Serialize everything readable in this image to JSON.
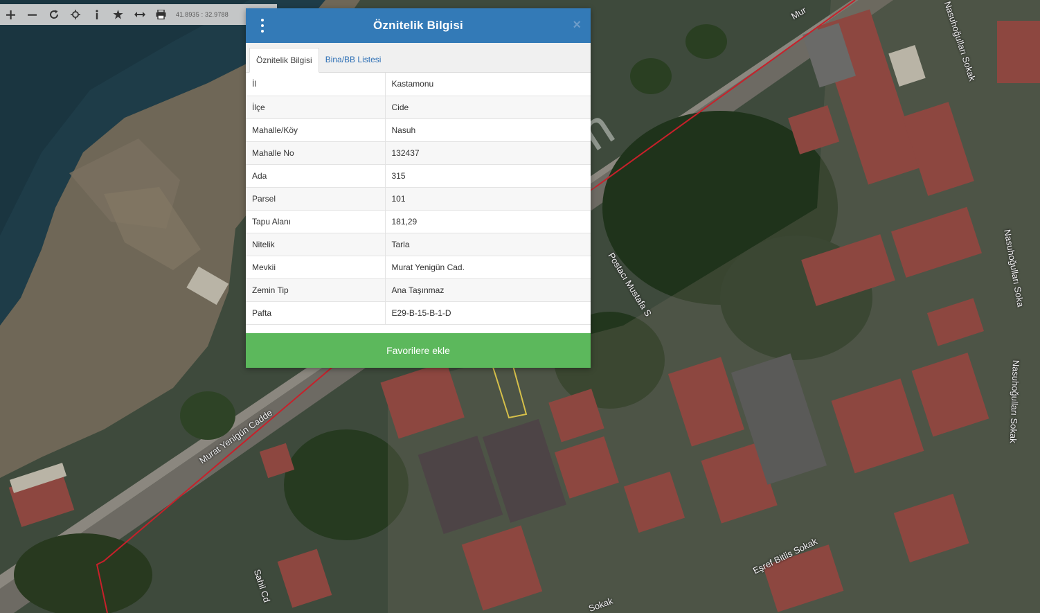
{
  "toolbar": {
    "tools": [
      {
        "name": "zoom-in-icon",
        "glyph": "+"
      },
      {
        "name": "zoom-out-icon",
        "glyph": "−"
      },
      {
        "name": "refresh-icon",
        "glyph": "⟳"
      },
      {
        "name": "locate-icon",
        "glyph": "✥"
      },
      {
        "name": "info-icon",
        "glyph": "i"
      },
      {
        "name": "star-icon",
        "glyph": "★"
      },
      {
        "name": "measure-icon",
        "glyph": "↔"
      },
      {
        "name": "print-icon",
        "glyph": "⎙"
      }
    ],
    "coordinates": "41.8935 : 32.9788"
  },
  "dialog": {
    "title": "Öznitelik Bilgisi",
    "close_glyph": "×",
    "tabs": [
      {
        "label": "Öznitelik Bilgisi",
        "active": true
      },
      {
        "label": "Bina/BB Listesi",
        "active": false
      }
    ],
    "rows": [
      {
        "key": "İl",
        "value": "Kastamonu"
      },
      {
        "key": "İlçe",
        "value": "Cide"
      },
      {
        "key": "Mahalle/Köy",
        "value": "Nasuh"
      },
      {
        "key": "Mahalle No",
        "value": "132437"
      },
      {
        "key": "Ada",
        "value": "315"
      },
      {
        "key": "Parsel",
        "value": "101"
      },
      {
        "key": "Tapu Alanı",
        "value": "181,29"
      },
      {
        "key": "Nitelik",
        "value": "Tarla"
      },
      {
        "key": "Mevkii",
        "value": "Murat Yenigün Cad."
      },
      {
        "key": "Zemin Tip",
        "value": "Ana Taşınmaz"
      },
      {
        "key": "Pafta",
        "value": "E29-B-15-B-1-D"
      }
    ],
    "favorite_button": "Favorilere ekle"
  },
  "map": {
    "streets": {
      "murat_yenigun": "Murat Yenigün Cadde",
      "murat_top": "Mur",
      "postaci": "Postacı Mustafa S",
      "nasuhogullari_1": "Nasuhoğulları Sokak",
      "nasuhogullari_2": "Nasuhoğulları Soka",
      "nasuhogullari_3": "Nasuhoğulları Sokak",
      "esref_bitlis": "Eşref Bitlis Sokak",
      "sahil": "Sahil Cd",
      "bottom": "Sokak"
    },
    "colors": {
      "sea": "#1d3a45",
      "beach": "#6e6658",
      "vegetation": "#26391f",
      "roof": "#8a4a42",
      "parcel_line": "#c8202a"
    }
  },
  "watermark": "emlakjet.com"
}
